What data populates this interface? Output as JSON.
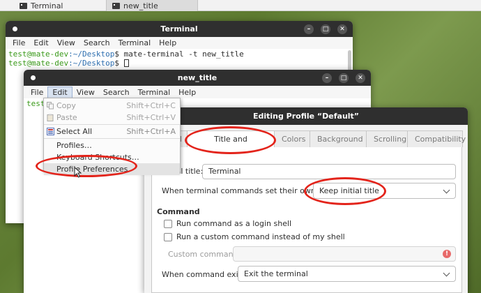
{
  "taskbar": {
    "items": [
      {
        "label": "Terminal",
        "icon": "terminal-icon",
        "active": false
      },
      {
        "label": "new_title",
        "icon": "terminal-icon",
        "active": true
      }
    ]
  },
  "back_terminal": {
    "title": "Terminal",
    "menu": [
      "File",
      "Edit",
      "View",
      "Search",
      "Terminal",
      "Help"
    ],
    "lines": [
      {
        "user": "test@mate-dev",
        "path": ":~/Desktop",
        "rest": "$ mate-terminal -t new_title"
      },
      {
        "user": "test@mate-dev",
        "path": ":~/Desktop",
        "rest": "$ "
      }
    ]
  },
  "front_terminal": {
    "title": "new_title",
    "menu": [
      "File",
      "Edit",
      "View",
      "Search",
      "Terminal",
      "Help"
    ],
    "open_menu": "Edit",
    "partial_line": "test"
  },
  "edit_menu": {
    "items": [
      {
        "label": "Copy",
        "accel": "Shift+Ctrl+C",
        "enabled": false,
        "icon": "copy-icon"
      },
      {
        "label": "Paste",
        "accel": "Shift+Ctrl+V",
        "enabled": false,
        "icon": "paste-icon"
      },
      {
        "label": "Select All",
        "accel": "Shift+Ctrl+A",
        "enabled": true,
        "icon": "select-all-icon"
      },
      {
        "label": "Profiles…",
        "accel": "",
        "enabled": true,
        "icon": ""
      },
      {
        "label": "Keyboard Shortcuts…",
        "accel": "",
        "enabled": true,
        "icon": ""
      },
      {
        "label": "Profile Preferences",
        "accel": "",
        "enabled": true,
        "icon": "",
        "highlighted": true
      }
    ]
  },
  "profile_dialog": {
    "title": "Editing Profile “Default”",
    "tabs": [
      {
        "label": "General",
        "visible_label": "l",
        "active": false
      },
      {
        "label": "Title and Command",
        "active": true
      },
      {
        "label": "Colors",
        "active": false
      },
      {
        "label": "Background",
        "active": false
      },
      {
        "label": "Scrolling",
        "active": false
      },
      {
        "label": "Compatibility",
        "active": false
      }
    ],
    "initial_title_label": "Initial title:",
    "initial_title_value": "Terminal",
    "dynamic_title_label": "When terminal commands set their own titles:",
    "dynamic_title_value": "Keep initial title",
    "command_section": "Command",
    "login_shell_label": "Run command as a login shell",
    "custom_command_check_label": "Run a custom command instead of my shell",
    "custom_command_label": "Custom command:",
    "custom_command_value": "",
    "exit_label": "When command exits:",
    "exit_value": "Exit the terminal"
  },
  "annotations": {
    "color": "#e3241b"
  }
}
